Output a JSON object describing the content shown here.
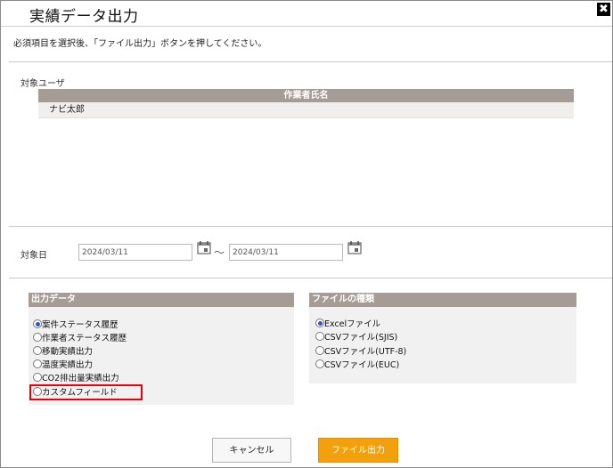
{
  "dialog": {
    "title": "実績データ出力",
    "close_glyph": "✖",
    "instruction": "必須項目を選択後、「ファイル出力」ボタンを押してください。"
  },
  "target_user": {
    "label": "対象ユーザ",
    "column_header": "作業者氏名",
    "rows": [
      "ナビ太郎"
    ]
  },
  "target_date": {
    "label": "対象日",
    "from": "2024/03/11",
    "separator": "～",
    "to": "2024/03/11",
    "calendar_icon": "calendar-icon"
  },
  "output_data": {
    "header": "出力データ",
    "options": [
      {
        "label": "案件ステータス履歴",
        "checked": true
      },
      {
        "label": "作業者ステータス履歴",
        "checked": false
      },
      {
        "label": "移動実績出力",
        "checked": false
      },
      {
        "label": "温度実績出力",
        "checked": false
      },
      {
        "label": "CO2排出量実績出力",
        "checked": false
      },
      {
        "label": "カスタムフィールド",
        "checked": false
      }
    ]
  },
  "file_type": {
    "header": "ファイルの種類",
    "options": [
      {
        "label": "Excelファイル",
        "checked": true
      },
      {
        "label": "CSVファイル(SJIS)",
        "checked": false
      },
      {
        "label": "CSVファイル(UTF-8)",
        "checked": false
      },
      {
        "label": "CSVファイル(EUC)",
        "checked": false
      }
    ]
  },
  "buttons": {
    "cancel": "キャンセル",
    "export": "ファイル出力"
  },
  "colors": {
    "header_bg": "#a69c96",
    "export_button": "#f2a10c",
    "highlight": "#e8000b"
  }
}
